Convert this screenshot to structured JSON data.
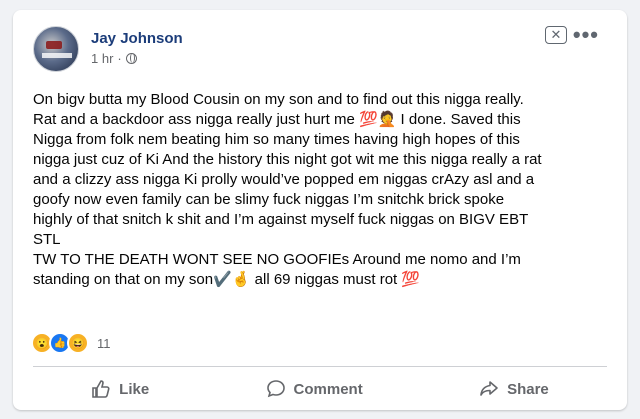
{
  "post": {
    "author": "Jay Johnson",
    "time": "1 hr",
    "separator": "·",
    "text": "On bigv butta my Blood Cousin on my son and to find out this nigga really.\nRat and a backdoor ass nigga really just hurt me 💯🤦 I done. Saved this\nNigga from folk nem beating him so many times having high hopes of this\nnigga just cuz of Ki And the history this night got wit me this nigga really a rat\nand a clizzy ass nigga Ki prolly would’ve popped em niggas crAzy asl and a\ngoofy now even family can be slimy fuck niggas I’m snitchk brick spoke\nhighly of that snitch k shit and I’m against myself fuck niggas on BIGV EBT\nSTL\nTW TO THE DEATH WONT SEE NO GOOFIEs Around me nomo and I’m\nstanding on that on my son✔️🤞 all 69 niggas must rot 💯"
  },
  "header_icons": {
    "close": "✕",
    "more": "•••",
    "globe": "globe-icon"
  },
  "reactions": {
    "icons": [
      "😮",
      "👍",
      "😆"
    ],
    "count": "11"
  },
  "actions": {
    "like_label": "Like",
    "comment_label": "Comment",
    "share_label": "Share"
  }
}
